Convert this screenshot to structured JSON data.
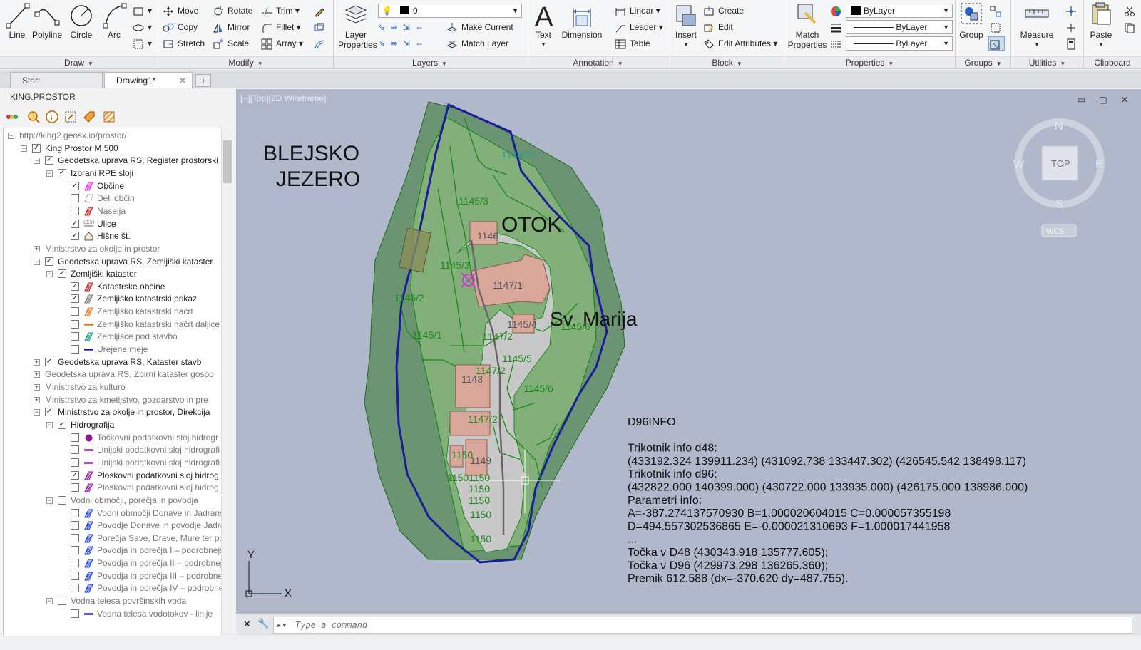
{
  "ribbon": {
    "draw": {
      "title": "Draw",
      "line": "Line",
      "polyline": "Polyline",
      "circle": "Circle",
      "arc": "Arc"
    },
    "modify": {
      "title": "Modify",
      "move": "Move",
      "rotate": "Rotate",
      "trim": "Trim",
      "copy": "Copy",
      "mirror": "Mirror",
      "fillet": "Fillet",
      "stretch": "Stretch",
      "scale": "Scale",
      "array": "Array"
    },
    "layers": {
      "title": "Layers",
      "layer_properties": "Layer Properties",
      "layer_value": "0",
      "make_current": "Make Current",
      "match_layer": "Match Layer"
    },
    "annotation": {
      "title": "Annotation",
      "text": "Text",
      "dimension": "Dimension",
      "linear": "Linear",
      "leader": "Leader",
      "table": "Table"
    },
    "block": {
      "title": "Block",
      "insert": "Insert",
      "create": "Create",
      "edit": "Edit",
      "edit_attributes": "Edit Attributes"
    },
    "properties": {
      "title": "Properties",
      "match_properties": "Match Properties",
      "color": "ByLayer",
      "linetype": "ByLayer",
      "lineweight": "ByLayer"
    },
    "groups": {
      "title": "Groups",
      "group": "Group"
    },
    "utilities": {
      "title": "Utilities",
      "measure": "Measure"
    },
    "clipboard": {
      "title": "Clipboard",
      "paste": "Paste"
    }
  },
  "tabs": [
    {
      "label": "Start"
    },
    {
      "label": "Drawing1*"
    }
  ],
  "left_panel": {
    "title": "KING.PROSTOR",
    "tree": [
      {
        "label": "http://king2.geosx.io/prostor/",
        "level": 0,
        "exp": "−",
        "cb": null,
        "style": "gray"
      },
      {
        "label": "King Prostor M 500",
        "level": 1,
        "exp": "−",
        "cb": "✓",
        "style": ""
      },
      {
        "label": "Geodetska uprava RS, Register prostorski",
        "level": 2,
        "exp": "−",
        "cb": "✓",
        "style": ""
      },
      {
        "label": "Izbrani RPE sloji",
        "level": 3,
        "exp": "−",
        "cb": "✓",
        "style": ""
      },
      {
        "label": "Občine",
        "level": 4,
        "exp": null,
        "cb": "✓",
        "style": "",
        "icon": "magenta-hatch"
      },
      {
        "label": "Deli občin",
        "level": 4,
        "exp": null,
        "cb": "",
        "style": "gray",
        "icon": "gray-outline"
      },
      {
        "label": "Naselja",
        "level": 4,
        "exp": null,
        "cb": "",
        "style": "gray",
        "icon": "red-hatch"
      },
      {
        "label": "Ulice",
        "level": 4,
        "exp": null,
        "cb": "✓",
        "style": "",
        "icon": "street"
      },
      {
        "label": "Hišne št.",
        "level": 4,
        "exp": null,
        "cb": "✓",
        "style": "",
        "icon": "house"
      },
      {
        "label": "Ministrstvo za okolje in prostor",
        "level": 2,
        "exp": "+",
        "cb": null,
        "style": "gray"
      },
      {
        "label": "Geodetska uprava RS, Zemljiški kataster",
        "level": 2,
        "exp": "−",
        "cb": "✓",
        "style": ""
      },
      {
        "label": "Zemljiški kataster",
        "level": 3,
        "exp": "−",
        "cb": "✓",
        "style": ""
      },
      {
        "label": "Katastrske občine",
        "level": 4,
        "exp": null,
        "cb": "✓",
        "style": "",
        "icon": "red-hatch"
      },
      {
        "label": "Zemljiško katastrski prikaz",
        "level": 4,
        "exp": null,
        "cb": "✓",
        "style": "",
        "icon": "gray-hatch"
      },
      {
        "label": "Zemljiško katastrski načrt",
        "level": 4,
        "exp": null,
        "cb": "",
        "style": "gray",
        "icon": "orange-hatch"
      },
      {
        "label": "Zemljiško katastrski načrt daljice",
        "level": 4,
        "exp": null,
        "cb": "",
        "style": "gray",
        "icon": "orange-line"
      },
      {
        "label": "Zemljišče pod stavbo",
        "level": 4,
        "exp": null,
        "cb": "",
        "style": "gray",
        "icon": "teal-hatch"
      },
      {
        "label": "Urejene meje",
        "level": 4,
        "exp": null,
        "cb": "",
        "style": "gray",
        "icon": "blue-line"
      },
      {
        "label": "Geodetska uprava RS, Kataster stavb",
        "level": 2,
        "exp": "+",
        "cb": "✓",
        "style": ""
      },
      {
        "label": "Geodetska uprava RS, Zbirni kataster gospo",
        "level": 2,
        "exp": "+",
        "cb": null,
        "style": "gray"
      },
      {
        "label": "Ministrstvo za kulturo",
        "level": 2,
        "exp": "+",
        "cb": null,
        "style": "gray"
      },
      {
        "label": "Ministrstvo za kmetijstvo, gozdarstvo in pre",
        "level": 2,
        "exp": "+",
        "cb": null,
        "style": "gray"
      },
      {
        "label": "Ministrstvo za okolje in prostor, Direkcija",
        "level": 2,
        "exp": "−",
        "cb": "✓",
        "style": ""
      },
      {
        "label": "Hidrografija",
        "level": 3,
        "exp": "−",
        "cb": "✓",
        "style": ""
      },
      {
        "label": "Točkovni podatkovni sloj hidrogr",
        "level": 4,
        "exp": null,
        "cb": "",
        "style": "gray",
        "icon": "purple-dot"
      },
      {
        "label": "Linijski podatkovni sloj hidrografi",
        "level": 4,
        "exp": null,
        "cb": "",
        "style": "gray",
        "icon": "purple-line"
      },
      {
        "label": "Linijski podatkovni sloj hidrografi",
        "level": 4,
        "exp": null,
        "cb": "",
        "style": "gray",
        "icon": "purple-line"
      },
      {
        "label": "Ploskovni podatkovni sloj hidrog",
        "level": 4,
        "exp": null,
        "cb": "✓",
        "style": "",
        "icon": "purple-hatch"
      },
      {
        "label": "Ploskovni podatkovni sloj hidrog",
        "level": 4,
        "exp": null,
        "cb": "",
        "style": "gray",
        "icon": "purple-hatch"
      },
      {
        "label": "Vodni območji, porečja in povodja",
        "level": 3,
        "exp": "−",
        "cb": "",
        "style": "gray"
      },
      {
        "label": "Vodni območji Donave in Jadrans",
        "level": 4,
        "exp": null,
        "cb": "",
        "style": "gray",
        "icon": "blue-hatch"
      },
      {
        "label": "Povodje Donave in povodje Jadra",
        "level": 4,
        "exp": null,
        "cb": "",
        "style": "gray",
        "icon": "blue-hatch"
      },
      {
        "label": "Porečja Save, Drave, Mure ter pov",
        "level": 4,
        "exp": null,
        "cb": "",
        "style": "gray",
        "icon": "blue-hatch"
      },
      {
        "label": "Povodja in porečja I – podrobnejš",
        "level": 4,
        "exp": null,
        "cb": "",
        "style": "gray",
        "icon": "blue-hatch"
      },
      {
        "label": "Povodja in porečja II – podrobnej",
        "level": 4,
        "exp": null,
        "cb": "",
        "style": "gray",
        "icon": "blue-hatch"
      },
      {
        "label": "Povodja in porečja III – podrobne",
        "level": 4,
        "exp": null,
        "cb": "",
        "style": "gray",
        "icon": "blue-hatch"
      },
      {
        "label": "Povodja in porečja IV – podrobne",
        "level": 4,
        "exp": null,
        "cb": "",
        "style": "gray",
        "icon": "blue-hatch"
      },
      {
        "label": "Vodna telesa površinskih voda",
        "level": 3,
        "exp": "−",
        "cb": "",
        "style": "gray"
      },
      {
        "label": "Vodna telesa vodotokov - linije",
        "level": 4,
        "exp": null,
        "cb": "",
        "style": "gray",
        "icon": "blue-line"
      }
    ]
  },
  "viewport": {
    "label": "[−][Top][2D Wireframe]",
    "map_labels": {
      "lake_line1": "BLEJSKO",
      "lake_line2": "JEZERO",
      "island": "OTOK",
      "church": "Sv. Marija"
    },
    "parcels": [
      "1144/27",
      "1145/3",
      "1146",
      "1145/3",
      "1147/1",
      "1145/2",
      "1145/4",
      "1145/6",
      "1145/1",
      "1147/2",
      "1145/5",
      "1148",
      "1147/2",
      "1145/6",
      "1147/2",
      "1150",
      "1149",
      "1150",
      "1150",
      "1150",
      "1150",
      "1150",
      "1150"
    ],
    "viewcube": {
      "n": "N",
      "s": "S",
      "e": "E",
      "w": "W",
      "top": "TOP",
      "wcs": "WCS"
    },
    "ucs": {
      "x": "X",
      "y": "Y"
    },
    "info_lines": [
      "D96INFO",
      "",
      "Trikotnik info d48:",
      "(433192.324 139911.234) (431092.738 133447.302) (426545.542 138498.117)",
      "Trikotnik info d96:",
      "(432822.000 140399.000) (430722.000 133935.000) (426175.000 138986.000)",
      "Parametri info:",
      "A=-387.274137570930 B=1.000020604015 C=0.000057355198",
      "D=494.557302536865 E=-0.000021310693 F=1.000017441958",
      "...",
      "Točka v D48 (430343.918 135777.605);",
      "Točka v D96 (429973.298 136265.360);",
      "Premik 612.588 (dx=-370.620 dy=487.755)."
    ]
  },
  "command": {
    "placeholder": "Type a command"
  },
  "colors": {
    "canvas": "#b1b8cb",
    "island_fill": "#6e9d6e",
    "parcel_line": "#1d8a1d",
    "outline": "#1a1a9a"
  }
}
